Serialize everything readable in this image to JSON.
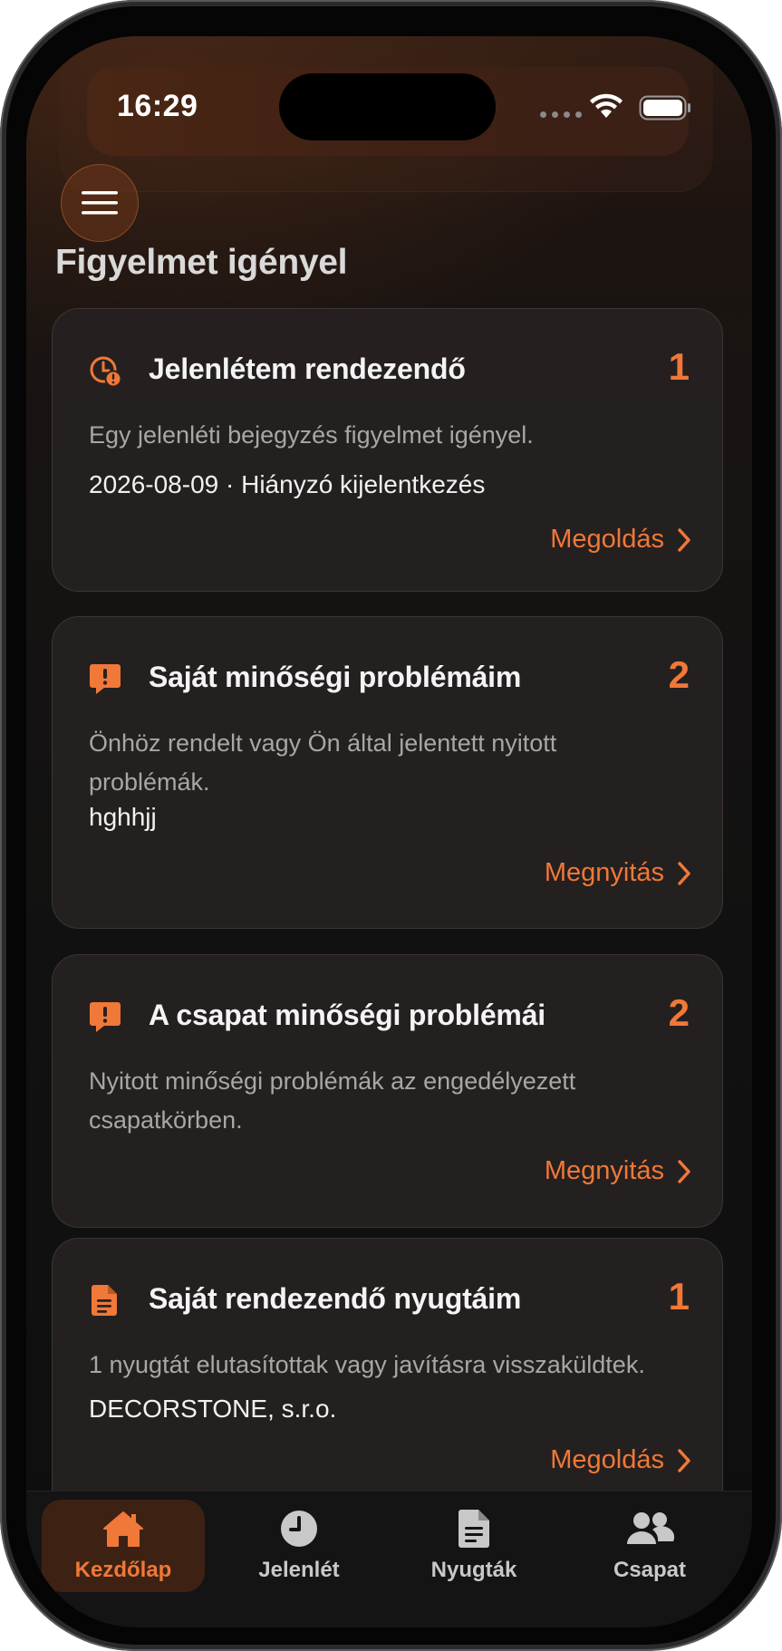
{
  "status_bar": {
    "time": "16:29"
  },
  "header": {
    "menu_icon": "hamburger-menu-icon"
  },
  "section": {
    "title": "Figyelmet igényel"
  },
  "cards": [
    {
      "icon": "clock-alert-icon",
      "title": "Jelenlétem rendezendő",
      "count": "1",
      "description": "Egy jelenléti bejegyzés figyelmet igényel.",
      "detail": "2026-08-09 · Hiányzó kijelentkezés",
      "action": "Megoldás"
    },
    {
      "icon": "alert-message-icon",
      "title": "Saját minőségi problémáim",
      "count": "2",
      "description": "Önhöz rendelt vagy Ön által jelentett nyitott problémák.",
      "detail": "hghhjj",
      "action": "Megnyitás"
    },
    {
      "icon": "alert-message-icon",
      "title": "A csapat minőségi problémái",
      "count": "2",
      "description": "Nyitott minőségi problémák az engedélyezett csapatkörben.",
      "action": "Megnyitás"
    },
    {
      "icon": "document-icon",
      "title": "Saját rendezendő nyugtáim",
      "count": "1",
      "description": "1 nyugtát elutasítottak vagy javításra visszaküldtek.",
      "detail": "DECORSTONE, s.r.o.",
      "action": "Megoldás"
    }
  ],
  "tabbar": {
    "tabs": [
      {
        "label": "Kezdőlap",
        "icon": "home-icon",
        "active": true
      },
      {
        "label": "Jelenlét",
        "icon": "clock-icon",
        "active": false
      },
      {
        "label": "Nyugták",
        "icon": "receipt-document-icon",
        "active": false
      },
      {
        "label": "Csapat",
        "icon": "team-people-icon",
        "active": false
      }
    ]
  },
  "colors": {
    "accent": "#f07838",
    "card_bg": "#262221",
    "background": "#111111"
  }
}
